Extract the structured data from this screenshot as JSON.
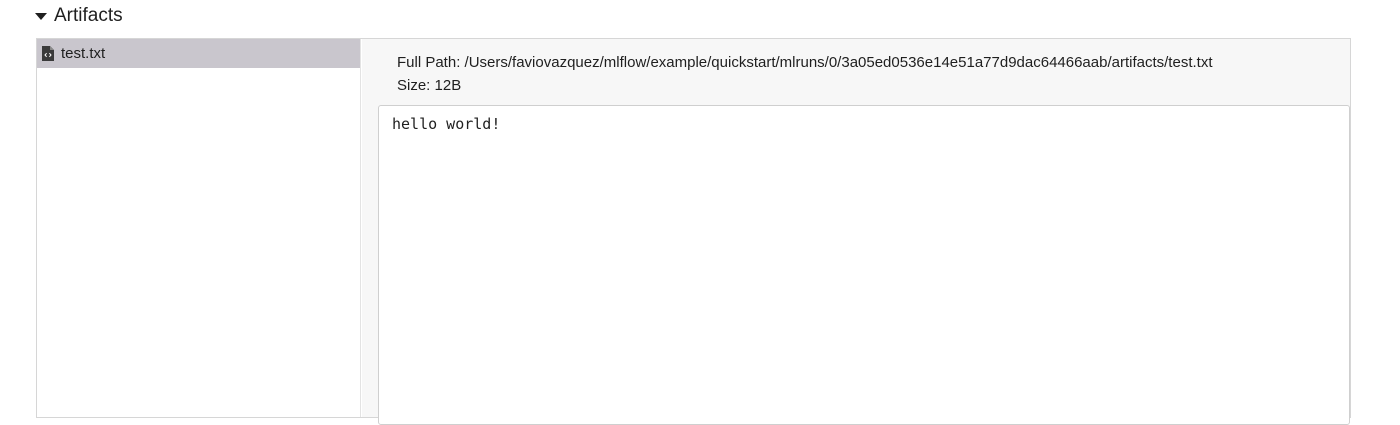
{
  "section": {
    "title": "Artifacts",
    "toggle_icon": "caret-down-icon"
  },
  "file_tree": {
    "items": [
      {
        "label": "test.txt",
        "icon": "file-code-icon",
        "selected": true
      }
    ]
  },
  "viewer": {
    "full_path_label": "Full Path:",
    "full_path": "/Users/faviovazquez/mlflow/example/quickstart/mlruns/0/3a05ed0536e14e51a77d9dac64466aab/artifacts/test.txt",
    "size_label": "Size:",
    "size": "12B",
    "file_content": "hello world!"
  },
  "colors": {
    "selected_row": "#c9c6cd",
    "viewer_background": "#f7f7f7",
    "border": "#d6d6d6"
  }
}
